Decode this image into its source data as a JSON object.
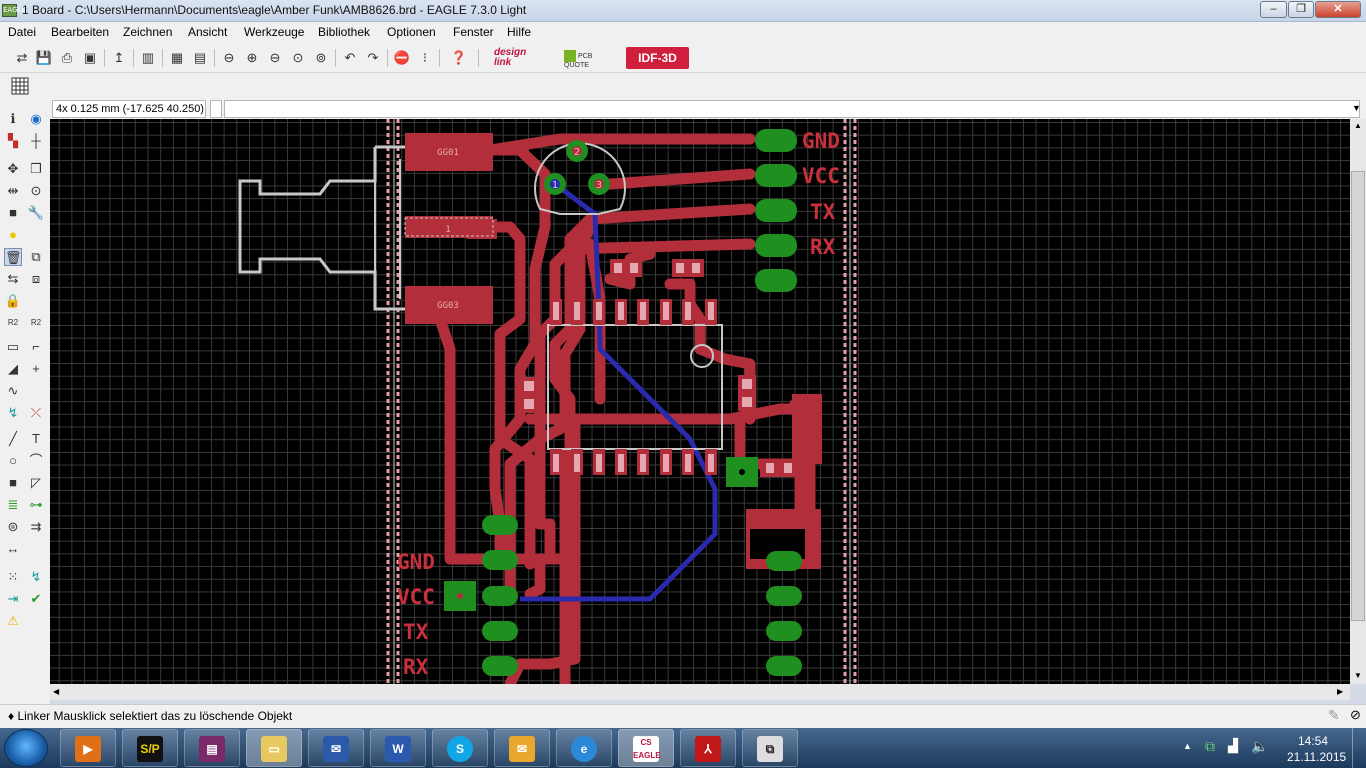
{
  "window": {
    "title": "1 Board - C:\\Users\\Hermann\\Documents\\eagle\\Amber Funk\\AMB8626.brd - EAGLE 7.3.0 Light",
    "app_icon": "EAGLE"
  },
  "menu": [
    "Datei",
    "Bearbeiten",
    "Zeichnen",
    "Ansicht",
    "Werkzeuge",
    "Bibliothek",
    "Optionen",
    "Fenster",
    "Hilfe"
  ],
  "toolbar": {
    "designlink": "design link",
    "pcbquote": "PCB QUOTE",
    "idf3d": "IDF-3D"
  },
  "coords": "4x 0.125 mm (-17.625 40.250)",
  "command_input": "",
  "board": {
    "left_labels": [
      "GND",
      "VCC",
      "TX",
      "RX"
    ],
    "right_labels": [
      "GND",
      "VCC",
      "TX",
      "RX"
    ],
    "pad_top": "GG01",
    "pad_mid": "1",
    "pad_bottom": "GG03",
    "via_labels": [
      "1",
      "2",
      "3"
    ]
  },
  "status": "♦ Linker Mausklick selektiert das zu löschende Objekt",
  "taskbar": {
    "time": "14:54",
    "date": "21.11.2015",
    "apps": [
      "video-player",
      "S/P",
      "winrar",
      "explorer",
      "mail",
      "W",
      "S",
      "lync",
      "e",
      "CS EAGLE",
      "pdf",
      "eagle-tool"
    ]
  },
  "colors": {
    "copper": "#b22e3a",
    "bottom_trace": "#2a2aad",
    "pad": "#1f8f1f",
    "silkscreen": "#c8c8c8",
    "label_red": "#c9303c"
  }
}
